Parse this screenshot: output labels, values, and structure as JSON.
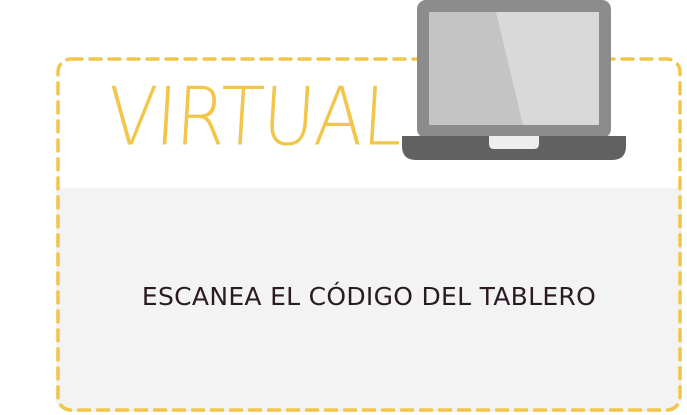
{
  "card": {
    "title": "VIRTUAL",
    "instruction": "ESCANEA EL CÓDIGO DEL TABLERO"
  },
  "icons": {
    "device": "laptop-icon"
  },
  "colors": {
    "accent_yellow": "#f2c64a",
    "body_gray": "#f3f3f3",
    "text_dark": "#2a1a24",
    "laptop_frame": "#8c8c8c",
    "laptop_base": "#616161",
    "laptop_screen": "#c4c4c4"
  }
}
